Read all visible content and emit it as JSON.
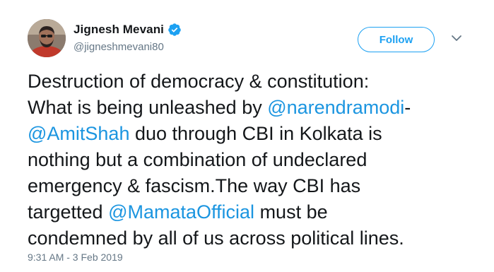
{
  "author": {
    "display_name": "Jignesh Mevani",
    "handle": "@jigneshmevani80",
    "verified": true,
    "verified_icon": "verified-badge-icon"
  },
  "actions": {
    "follow_label": "Follow",
    "menu_icon": "chevron-down-icon"
  },
  "tweet": {
    "lines": [
      [
        "Destruction of democracy & constitution:"
      ],
      [
        "What is being unleashed by ",
        "@narendramodi",
        "-"
      ],
      [
        "@AmitShah",
        " duo through CBI in Kolkata is"
      ],
      [
        "nothing but a combination of undeclared"
      ],
      [
        "emergency & fascism.The way CBI has"
      ],
      [
        "targetted ",
        "@MamataOfficial",
        " must be"
      ],
      [
        "condemned by all of us across political lines."
      ]
    ],
    "mentions": [
      "@narendramodi",
      "@AmitShah",
      "@MamataOfficial"
    ],
    "timestamp": "9:31 AM - 3 Feb 2019"
  },
  "colors": {
    "accent": "#1da1f2",
    "mention": "#1b95e0",
    "text": "#14171a",
    "secondary": "#657786"
  }
}
